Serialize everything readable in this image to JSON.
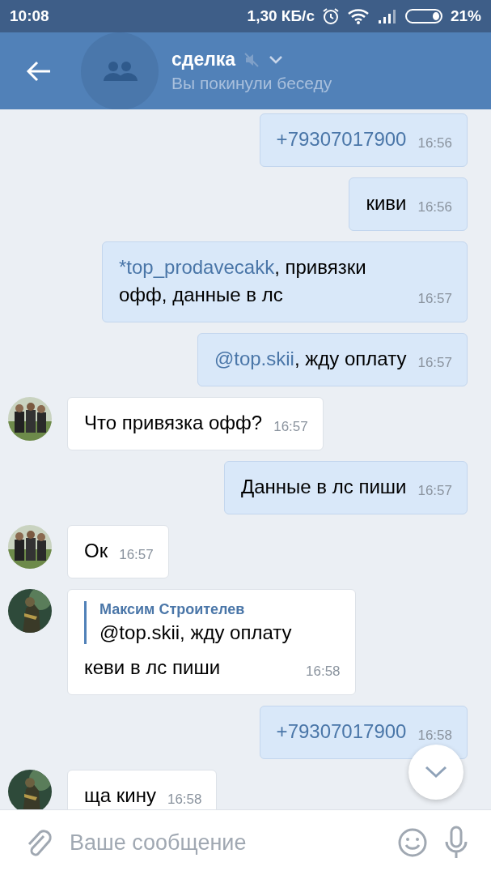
{
  "status_bar": {
    "time": "10:08",
    "speed": "1,30 КБ/с",
    "battery": "21%"
  },
  "header": {
    "title": "сделка",
    "muted": true,
    "subtitle": "Вы покинули беседу"
  },
  "messages": [
    {
      "kind": "outgoing",
      "parts": [
        {
          "kind": "phone",
          "text": "+79307017900"
        }
      ],
      "time": "16:56"
    },
    {
      "kind": "outgoing",
      "parts": [
        {
          "kind": "text",
          "text": "киви"
        }
      ],
      "time": "16:56"
    },
    {
      "kind": "outgoing",
      "parts": [
        {
          "kind": "mention",
          "text": "*top_prodavecakk"
        },
        {
          "kind": "text",
          "text": ", привязки офф, данные в лс"
        }
      ],
      "time": "16:57"
    },
    {
      "kind": "outgoing",
      "parts": [
        {
          "kind": "mention",
          "text": "@top.skii"
        },
        {
          "kind": "text",
          "text": ", жду оплату"
        }
      ],
      "time": "16:57"
    },
    {
      "kind": "incoming",
      "avatar": {
        "kind": "picture"
      },
      "parts": [
        {
          "kind": "text",
          "text": "Что привязка офф?"
        }
      ],
      "time": "16:57"
    },
    {
      "kind": "outgoing",
      "parts": [
        {
          "kind": "text",
          "text": "Данные в лс пиши"
        }
      ],
      "time": "16:57"
    },
    {
      "kind": "incoming",
      "avatar": {
        "kind": "picture"
      },
      "parts": [
        {
          "kind": "text",
          "text": "Ок"
        }
      ],
      "time": "16:57"
    },
    {
      "kind": "incoming",
      "avatar": {
        "kind": "picture"
      },
      "reply": {
        "author": "Максим Строителев",
        "text": "@top.skii, жду оплату"
      },
      "parts": [
        {
          "kind": "text",
          "text": "кеви в лс пиши"
        }
      ],
      "time": "16:58"
    },
    {
      "kind": "outgoing",
      "parts": [
        {
          "kind": "phone",
          "text": "+79307017900"
        }
      ],
      "time": "16:58"
    },
    {
      "kind": "incoming",
      "avatar": {
        "kind": "picture"
      },
      "parts": [
        {
          "kind": "text",
          "text": "ща кину"
        }
      ],
      "time": "16:58"
    }
  ],
  "composer": {
    "placeholder": "Ваше сообщение"
  }
}
